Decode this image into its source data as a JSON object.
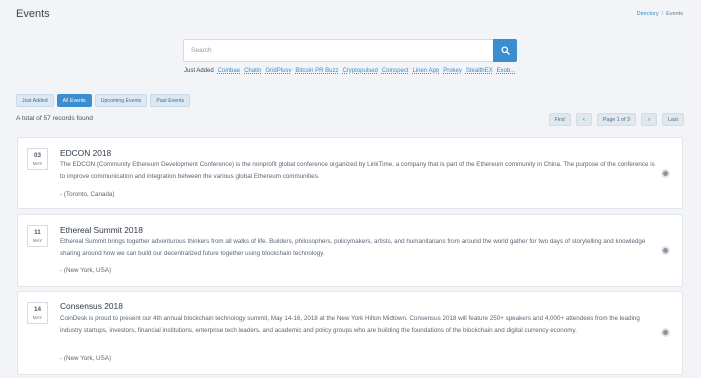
{
  "header": {
    "title": "Events"
  },
  "breadcrumb": {
    "directory": "Directory",
    "separator": "/",
    "current": "Events"
  },
  "search": {
    "placeholder": "Search",
    "button_icon": "search-icon"
  },
  "tags": {
    "label": "Just Added",
    "items": [
      "Coinbae",
      "Chatin",
      "GridPlusv",
      "Bitcoin PR Buzz",
      "Cryptopulsed",
      "Coinspect",
      "Linen App",
      "Prokey",
      "StealthEX",
      "Exob..."
    ]
  },
  "filters": [
    {
      "label": "Just Added",
      "active": false
    },
    {
      "label": "All Events",
      "active": true
    },
    {
      "label": "Upcoming Events",
      "active": false
    },
    {
      "label": "Past Events",
      "active": false
    }
  ],
  "total_text": "A total of 57 records found",
  "pagination": {
    "first": "First",
    "prev": "‹",
    "page": "Page 1 of 3",
    "next": "›",
    "last": "Last"
  },
  "events": [
    {
      "day": "03",
      "month": "MAY",
      "title": "EDCON 2018",
      "description": "The EDCON (Community Ethereum Development Conference) is the nonprofit global conference organized by LinkTime, a company that is part of the Ethereum community in China. The purpose of the conference is to improve communication and integration between the various global Ethereum communities.",
      "location": "- (Toronto, Canada)"
    },
    {
      "day": "11",
      "month": "MAY",
      "title": "Ethereal Summit 2018",
      "description": "Ethereal Summit brings together adventurous thinkers from all walks of life. Builders, philosophers, policymakers, artists, and humanitarians from around the world gather for two days of storytelling and knowledge sharing around how we can build our decentralized future together using blockchain technology.",
      "location": "- (New York, USA)"
    },
    {
      "day": "14",
      "month": "MAY",
      "title": "Consensus 2018",
      "description": "CoinDesk is proud to present our 4th annual blockchain technology summit, May 14-16, 2018 at the New York Hilton Midtown. Consensus 2018 will feature 250+ speakers and 4,000+ attendees from the leading industry startups, investors, financial institutions, enterprise tech leaders, and academic and policy groups who are building the foundations of the blockchain and digital currency economy.",
      "location": "- (New York, USA)"
    }
  ]
}
